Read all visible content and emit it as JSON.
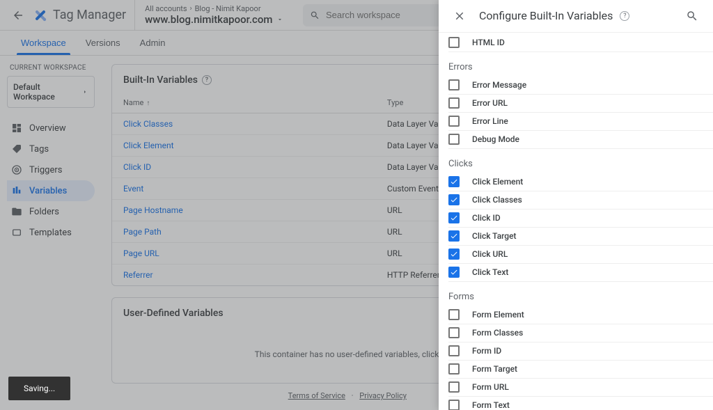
{
  "header": {
    "product": "Tag Manager",
    "breadcrumb_all": "All accounts",
    "breadcrumb_account": "Blog - Nimit Kapoor",
    "domain": "www.blog.nimitkapoor.com",
    "search_placeholder": "Search workspace"
  },
  "tabs": [
    {
      "id": "workspace",
      "label": "Workspace",
      "active": true
    },
    {
      "id": "versions",
      "label": "Versions",
      "active": false
    },
    {
      "id": "admin",
      "label": "Admin",
      "active": false
    }
  ],
  "sidebar": {
    "section_label": "CURRENT WORKSPACE",
    "workspace_name": "Default Workspace",
    "items": [
      {
        "id": "overview",
        "label": "Overview",
        "icon": "dashboard"
      },
      {
        "id": "tags",
        "label": "Tags",
        "icon": "tag"
      },
      {
        "id": "triggers",
        "label": "Triggers",
        "icon": "target"
      },
      {
        "id": "variables",
        "label": "Variables",
        "icon": "variables",
        "active": true
      },
      {
        "id": "folders",
        "label": "Folders",
        "icon": "folder"
      },
      {
        "id": "templates",
        "label": "Templates",
        "icon": "template"
      }
    ]
  },
  "builtins": {
    "title": "Built-In Variables",
    "columns": {
      "name": "Name",
      "type": "Type"
    },
    "rows": [
      {
        "name": "Click Classes",
        "type": "Data Layer Variable"
      },
      {
        "name": "Click Element",
        "type": "Data Layer Variable"
      },
      {
        "name": "Click ID",
        "type": "Data Layer Variable"
      },
      {
        "name": "Event",
        "type": "Custom Event"
      },
      {
        "name": "Page Hostname",
        "type": "URL"
      },
      {
        "name": "Page Path",
        "type": "URL"
      },
      {
        "name": "Page URL",
        "type": "URL"
      },
      {
        "name": "Referrer",
        "type": "HTTP Referrer"
      }
    ]
  },
  "userdef": {
    "title": "User-Defined Variables",
    "empty_text": "This container has no user-defined variables, click the \"New\" button to create one."
  },
  "toast": "Saving...",
  "footer": {
    "tos": "Terms of Service",
    "privacy": "Privacy Policy"
  },
  "panel": {
    "title": "Configure Built-In Variables",
    "pre_group": [
      {
        "label": "HTML ID",
        "checked": false
      }
    ],
    "groups": [
      {
        "title": "Errors",
        "items": [
          {
            "label": "Error Message",
            "checked": false
          },
          {
            "label": "Error URL",
            "checked": false
          },
          {
            "label": "Error Line",
            "checked": false
          },
          {
            "label": "Debug Mode",
            "checked": false
          }
        ]
      },
      {
        "title": "Clicks",
        "items": [
          {
            "label": "Click Element",
            "checked": true
          },
          {
            "label": "Click Classes",
            "checked": true
          },
          {
            "label": "Click ID",
            "checked": true
          },
          {
            "label": "Click Target",
            "checked": true
          },
          {
            "label": "Click URL",
            "checked": true
          },
          {
            "label": "Click Text",
            "checked": true
          }
        ]
      },
      {
        "title": "Forms",
        "items": [
          {
            "label": "Form Element",
            "checked": false
          },
          {
            "label": "Form Classes",
            "checked": false
          },
          {
            "label": "Form ID",
            "checked": false
          },
          {
            "label": "Form Target",
            "checked": false
          },
          {
            "label": "Form URL",
            "checked": false
          },
          {
            "label": "Form Text",
            "checked": false
          }
        ]
      }
    ]
  }
}
